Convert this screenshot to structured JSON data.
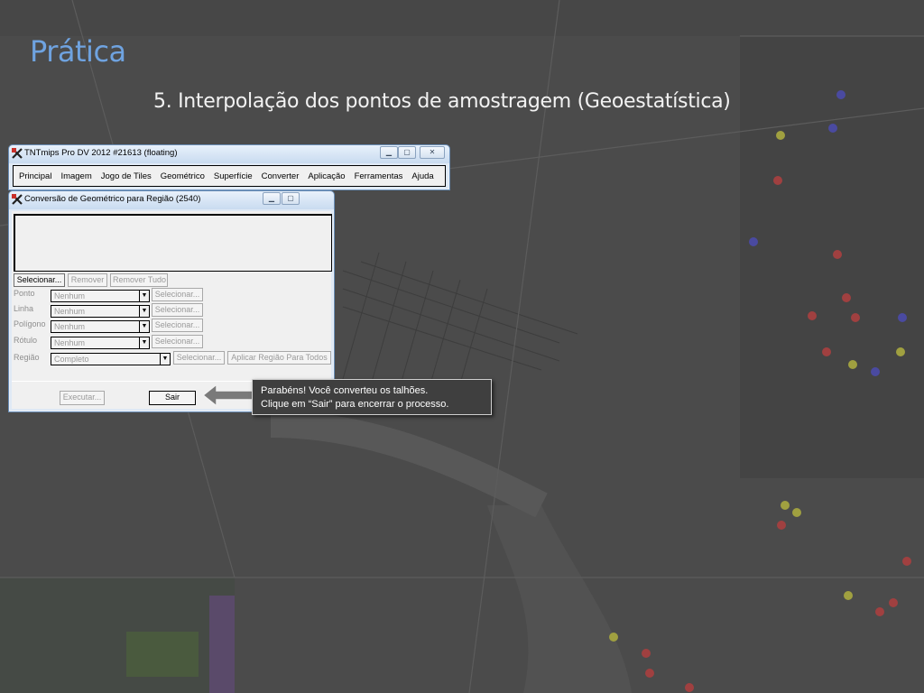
{
  "slide": {
    "title": "Prática",
    "subtitle": "5. Interpolação dos pontos de amostragem (Geoestatística)"
  },
  "main_window": {
    "title": "TNTmips Pro DV 2012  #21613 (floating)",
    "menu": [
      "Principal",
      "Imagem",
      "Jogo de Tiles",
      "Geométrico",
      "Superfície",
      "Converter",
      "Aplicação",
      "Ferramentas",
      "Ajuda"
    ]
  },
  "dialog": {
    "title": "Conversão de Geométrico para Região (2540)",
    "select_button": "Selecionar...",
    "remove_button": "Remover",
    "remove_all_button": "Remover Tudo",
    "rows": [
      {
        "label": "Ponto",
        "value": "Nenhum",
        "button": "Selecionar..."
      },
      {
        "label": "Linha",
        "value": "Nenhum",
        "button": "Selecionar..."
      },
      {
        "label": "Polígono",
        "value": "Nenhum",
        "button": "Selecionar..."
      },
      {
        "label": "Rótulo",
        "value": "Nenhum",
        "button": "Selecionar..."
      }
    ],
    "region": {
      "label": "Região",
      "value": "Completo",
      "select_button": "Selecionar...",
      "apply_all_button": "Aplicar Região Para Todos"
    },
    "execute_button": "Executar...",
    "exit_button": "Sair"
  },
  "callout": {
    "line1": "Parabéns! Você converteu os talhões.",
    "line2": "Clique em “Sair” para encerrar o processo."
  },
  "colors": {
    "title": "#6fa3e0",
    "background": "#4a4a4a",
    "callout_bg": "#3f3f3f"
  }
}
